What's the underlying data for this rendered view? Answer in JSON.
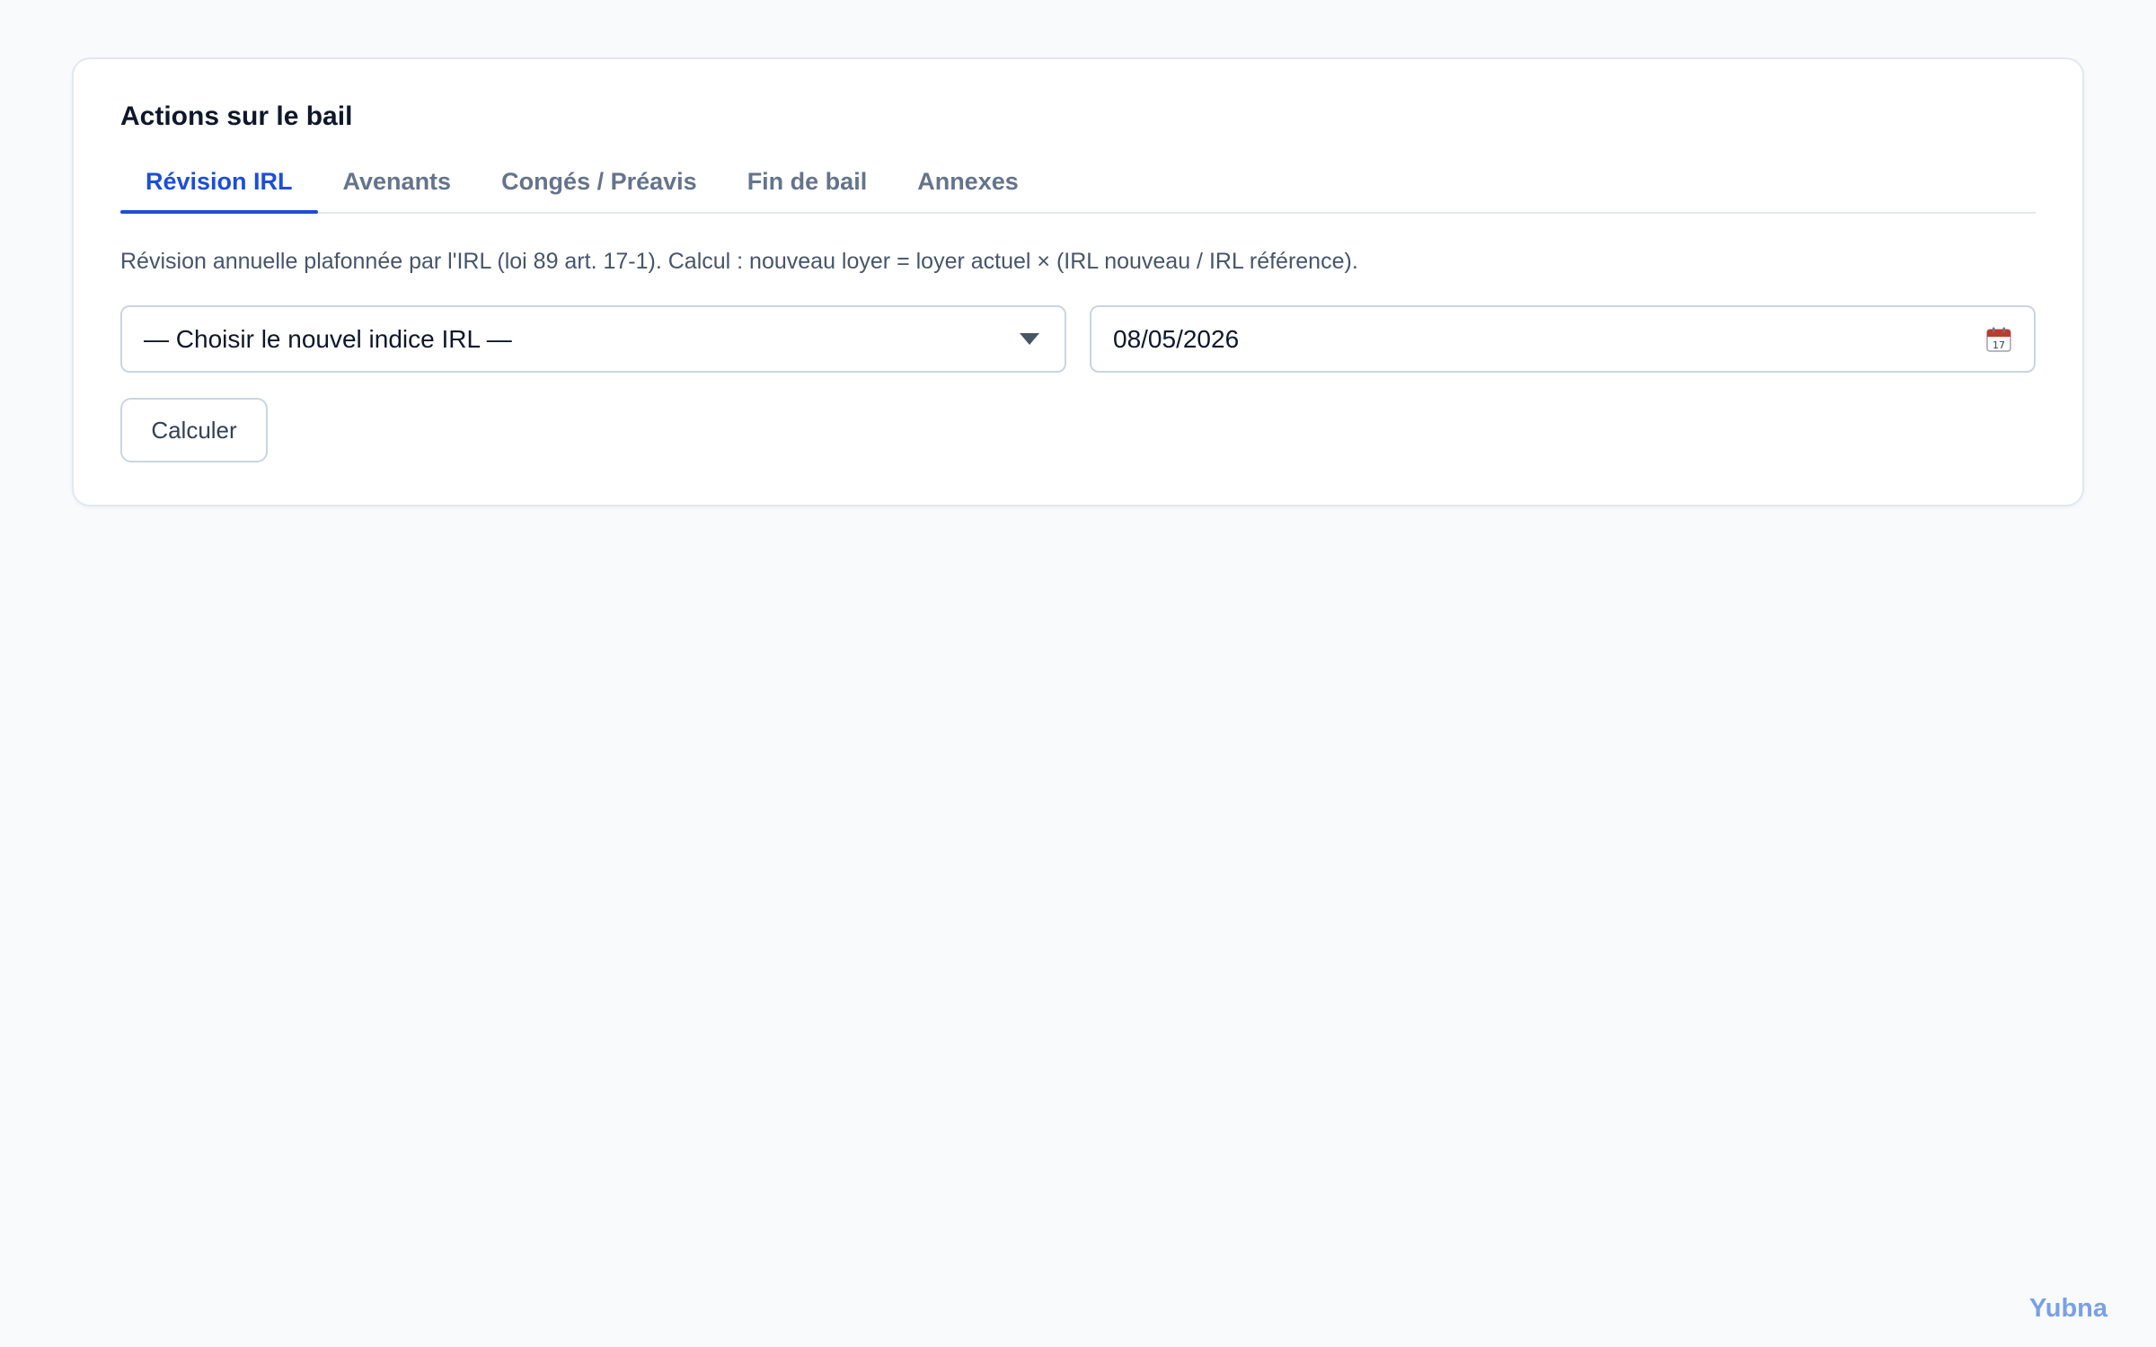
{
  "card": {
    "title": "Actions sur le bail"
  },
  "tabs": [
    {
      "label": "Révision IRL",
      "active": true
    },
    {
      "label": "Avenants",
      "active": false
    },
    {
      "label": "Congés / Préavis",
      "active": false
    },
    {
      "label": "Fin de bail",
      "active": false
    },
    {
      "label": "Annexes",
      "active": false
    }
  ],
  "irl": {
    "description": "Révision annuelle plafonnée par l'IRL (loi 89 art. 17-1). Calcul : nouveau loyer = loyer actuel × (IRL nouveau / IRL référence).",
    "index_select": {
      "selected": "— Choisir le nouvel indice IRL —",
      "icon": "chevron-down-icon"
    },
    "date_field": {
      "value": "08/05/2026",
      "icon": "calendar-icon"
    },
    "calculate_label": "Calculer"
  },
  "brand": {
    "name": "Yubna"
  },
  "colors": {
    "accent": "#1d4ed8",
    "background": "#f8fafc",
    "brand": "#7aa0e6"
  }
}
